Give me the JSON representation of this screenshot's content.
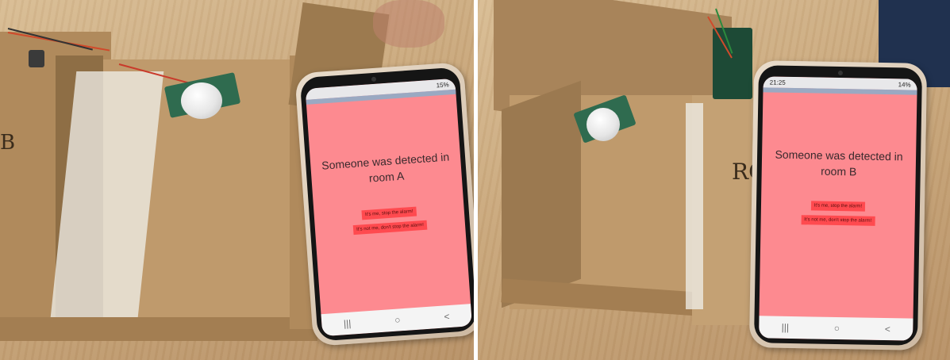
{
  "left_photo": {
    "phone": {
      "status": {
        "battery": "15%"
      },
      "message": "Someone was detected in room A",
      "button_stop": "It's me, stop the alarm!",
      "button_dont_stop": "It's not me, don't stop the alarm!",
      "nav": [
        "|||",
        "○",
        "<"
      ]
    },
    "box_label": "B"
  },
  "right_photo": {
    "phone": {
      "status": {
        "time": "21:25",
        "battery": "14%"
      },
      "message": "Someone was detected in room B",
      "button_stop": "It's me, stop the alarm!",
      "button_dont_stop": "It's not me, don't stop the alarm!",
      "nav": [
        "|||",
        "○",
        "<"
      ]
    },
    "box_label": "RC"
  },
  "colors": {
    "screen_bg": "#fd8a90",
    "button_bg": "#ff4a4f",
    "cardboard": "#b08a5c",
    "table": "#c9a77b"
  }
}
